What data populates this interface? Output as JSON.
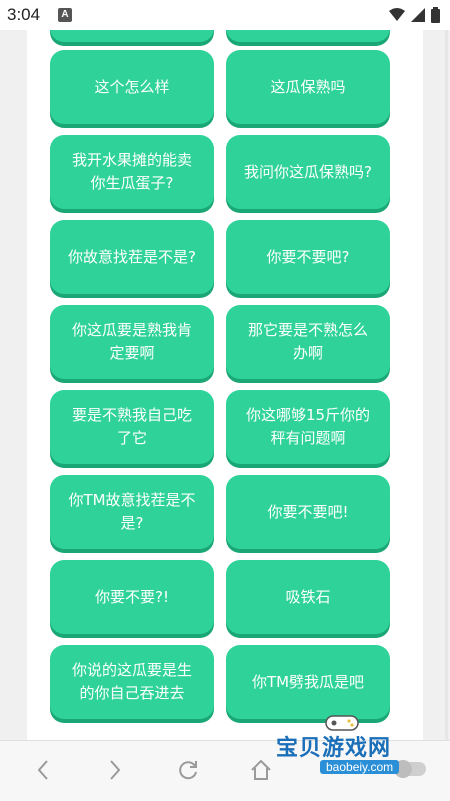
{
  "status_bar": {
    "time": "3:04",
    "notification_badge": "A",
    "icons": [
      "wifi-icon",
      "signal-icon",
      "battery-icon"
    ]
  },
  "buttons": [
    {
      "label": "这个怎么样"
    },
    {
      "label": "这瓜保熟吗"
    },
    {
      "label": "我开水果摊的能卖你生瓜蛋子?"
    },
    {
      "label": "我问你这瓜保熟吗?"
    },
    {
      "label": "你故意找茬是不是?"
    },
    {
      "label": "你要不要吧?"
    },
    {
      "label": "你这瓜要是熟我肯定要啊"
    },
    {
      "label": "那它要是不熟怎么办啊"
    },
    {
      "label": "要是不熟我自己吃了它"
    },
    {
      "label": "你这哪够15斤你的秤有问题啊"
    },
    {
      "label": "你TM故意找茬是不是?"
    },
    {
      "label": "你要不要吧!"
    },
    {
      "label": "你要不要?!"
    },
    {
      "label": "吸铁石"
    },
    {
      "label": "你说的这瓜要是生的你自己吞进去"
    },
    {
      "label": "你TM劈我瓜是吧"
    }
  ],
  "bottom_nav": {
    "icons": [
      "back-icon",
      "forward-icon",
      "refresh-icon",
      "home-icon"
    ]
  },
  "watermark": {
    "title": "宝贝游戏网",
    "url": "baobeiy.com"
  },
  "colors": {
    "button_bg": "#2fd39a",
    "button_shadow": "#1aa775",
    "button_text": "#ffffff"
  }
}
